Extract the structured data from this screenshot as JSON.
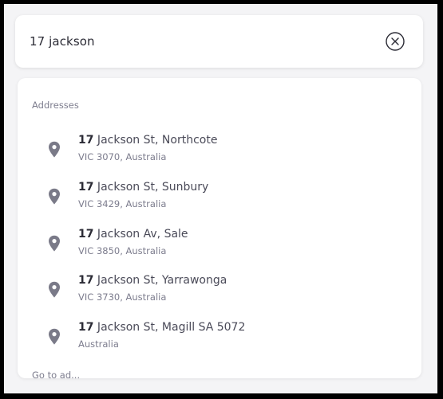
{
  "search": {
    "value": "17 jackson"
  },
  "dropdown": {
    "section_label": "Addresses",
    "next_section_label": "Go to ad...",
    "results": [
      {
        "number": "17",
        "street": " Jackson St, Northcote",
        "locality": "VIC 3070, Australia"
      },
      {
        "number": "17",
        "street": " Jackson St, Sunbury",
        "locality": "VIC 3429, Australia"
      },
      {
        "number": "17",
        "street": " Jackson Av, Sale",
        "locality": "VIC 3850, Australia"
      },
      {
        "number": "17",
        "street": " Jackson St, Yarrawonga",
        "locality": "VIC 3730, Australia"
      },
      {
        "number": "17",
        "street": " Jackson St, Magill SA 5072",
        "locality": "Australia"
      }
    ]
  },
  "colors": {
    "text_primary": "#2b2b35",
    "text_secondary": "#7d7d8e",
    "pin": "#7a7a88"
  },
  "icons": {
    "clear": "close-circle-icon",
    "result": "map-pin-icon"
  }
}
